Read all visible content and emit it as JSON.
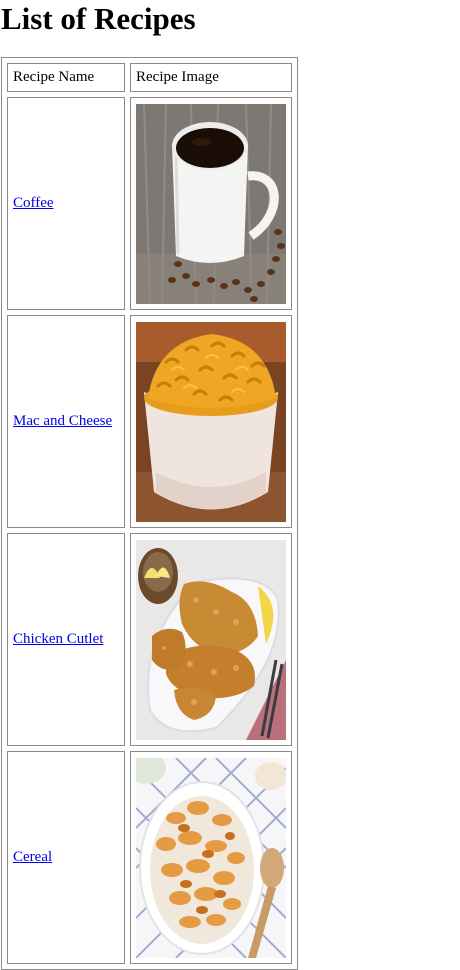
{
  "page": {
    "title": "List of Recipes"
  },
  "table": {
    "headers": {
      "name": "Recipe Name",
      "image": "Recipe Image"
    },
    "rows": [
      {
        "name": "Coffee",
        "image_icon": "coffee-mug-photo"
      },
      {
        "name": "Mac and Cheese",
        "image_icon": "mac-and-cheese-bowl-photo"
      },
      {
        "name": "Chicken Cutlet",
        "image_icon": "chicken-cutlet-plate-photo"
      },
      {
        "name": "Cereal",
        "image_icon": "cereal-bowl-photo"
      }
    ]
  },
  "colors": {
    "link": "#0000ee",
    "border": "#8a8a8a"
  }
}
